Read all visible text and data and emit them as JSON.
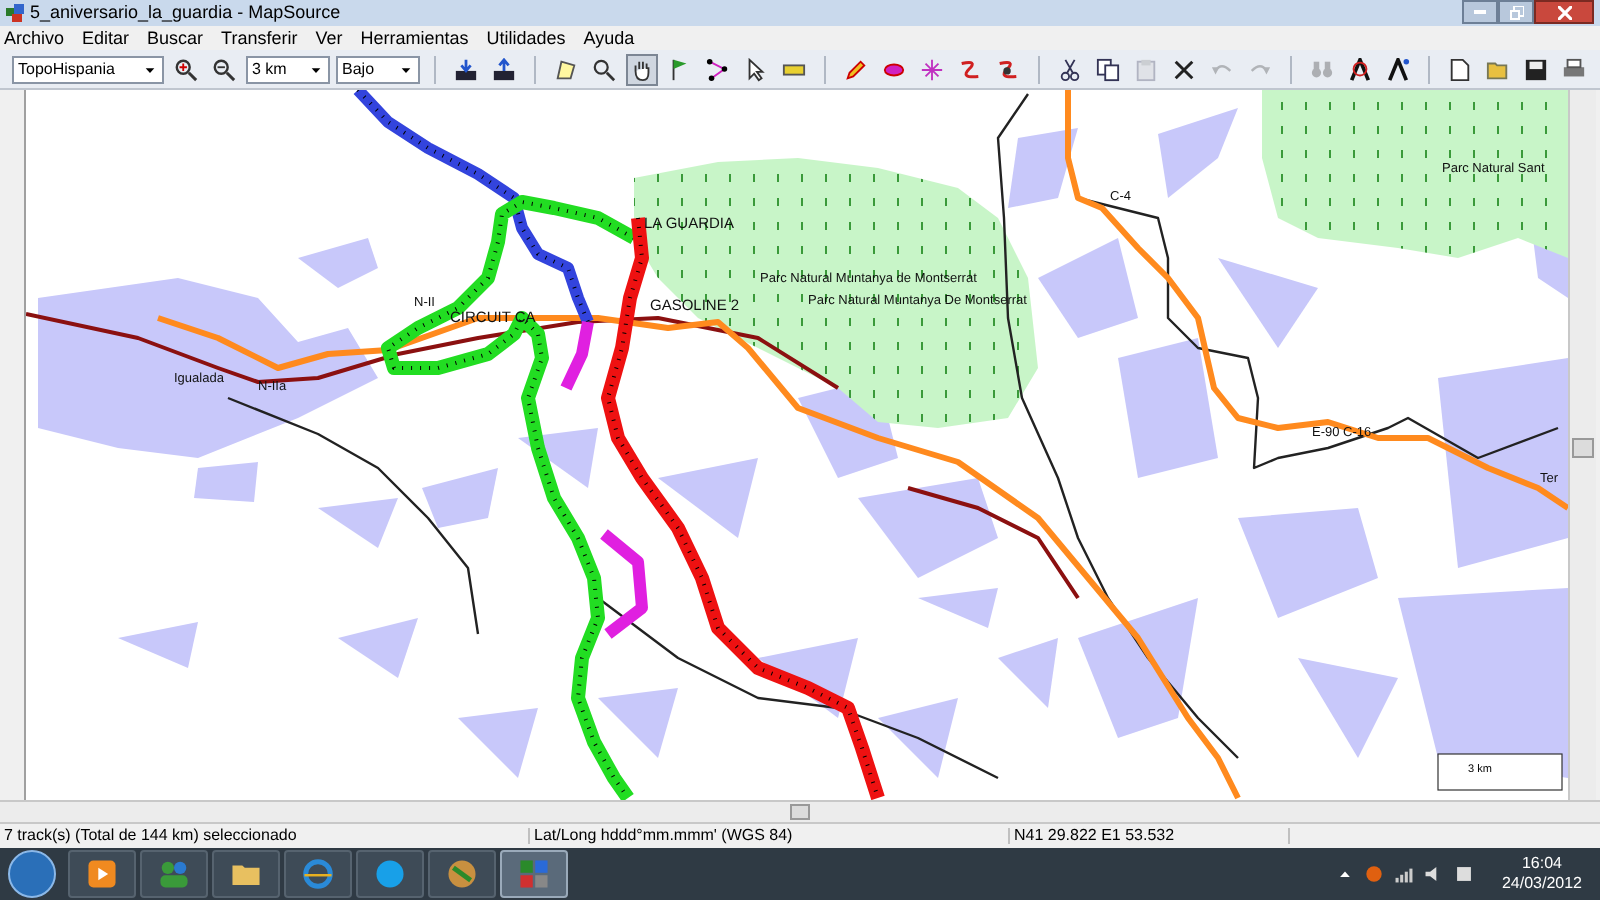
{
  "window": {
    "title": "5_aniversario_la_guardia - MapSource"
  },
  "menu": [
    "Archivo",
    "Editar",
    "Buscar",
    "Transferir",
    "Ver",
    "Herramientas",
    "Utilidades",
    "Ayuda"
  ],
  "toolbar": {
    "map_product": "TopoHispania",
    "zoom_scale": "3 km",
    "detail": "Bajo"
  },
  "tools": [
    {
      "selected": false
    },
    {
      "selected": false
    },
    {
      "selected": true
    },
    {
      "selected": false
    },
    {
      "selected": false
    },
    {
      "selected": false
    },
    {
      "selected": false
    }
  ],
  "edit_actions": [
    {
      "disabled": false
    },
    {
      "disabled": false
    },
    {
      "disabled": true
    },
    {
      "disabled": false
    },
    {
      "disabled": true
    },
    {
      "disabled": true
    }
  ],
  "map": {
    "labels": [
      "LA GUARDIA",
      "GASOLINE 2",
      "CIRCUIT CA",
      "N-II",
      "Igualada",
      "N-IIa",
      "Parc Natural Muntanya de Montserrat",
      "Parc Natural Muntanya De Montserrat",
      "C-4",
      "E-90 C-16",
      "Parc Natural Sant",
      "Ter"
    ],
    "scale": "3 km"
  },
  "status_bar": [
    "7 track(s) (Total de 144 km) seleccionado",
    "Lat/Long hddd°mm.mmm' (WGS 84)",
    "N41 29.822 E1 53.532"
  ],
  "taskbar": {
    "time": "16:04",
    "date": "24/03/2012"
  }
}
